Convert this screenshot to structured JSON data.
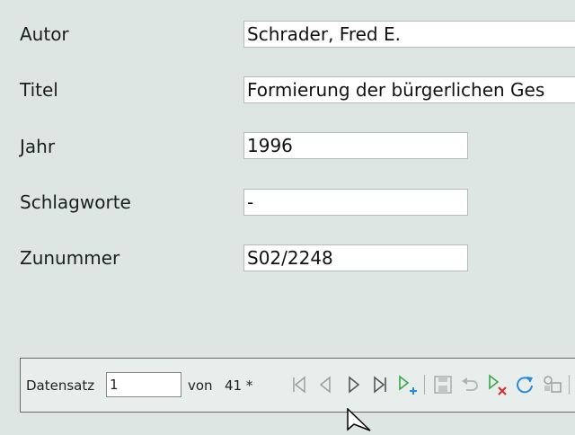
{
  "form": {
    "fields": [
      {
        "label": "Autor",
        "value": "Schrader, Fred E."
      },
      {
        "label": "Titel",
        "value": " Formierung der bürgerlichen Ges"
      },
      {
        "label": "Jahr",
        "value": "1996"
      },
      {
        "label": "Schlagworte",
        "value": "-"
      },
      {
        "label": "Zunummer",
        "value": "S02/2248"
      }
    ]
  },
  "navbar": {
    "record_label": "Datensatz",
    "record_value": "1",
    "of_label": "von",
    "total": "41 *"
  },
  "icons": {
    "first": "first-record-icon",
    "previous": "previous-record-icon",
    "next": "next-record-icon",
    "last": "last-record-icon",
    "new": "new-record-icon",
    "save": "save-record-icon",
    "undo": "undo-icon",
    "delete": "delete-record-icon",
    "refresh": "refresh-icon",
    "filter": "filter-icon"
  },
  "colors": {
    "background": "#dde6e3",
    "accent_green": "#3aa64a",
    "delete_red": "#d62b2b",
    "refresh_blue": "#2a8ad4"
  }
}
